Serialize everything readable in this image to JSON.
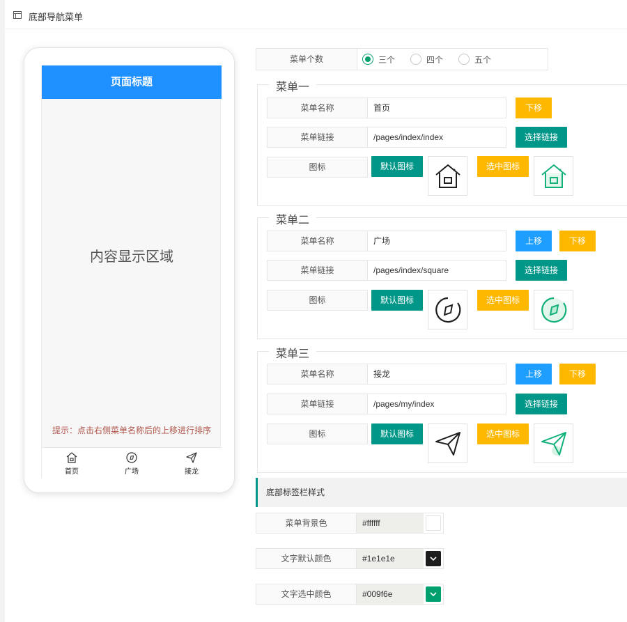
{
  "topbar": {
    "title": "底部导航菜单"
  },
  "phone": {
    "page_title": "页面标题",
    "content": "内容显示区域",
    "tip": "提示：点击右侧菜单名称后的上移进行排序",
    "tabs": [
      {
        "label": "首页",
        "icon": "home-icon"
      },
      {
        "label": "广场",
        "icon": "compass-icon"
      },
      {
        "label": "接龙",
        "icon": "paper-plane-icon"
      }
    ]
  },
  "count": {
    "label": "菜单个数",
    "options": [
      "三个",
      "四个",
      "五个"
    ],
    "selected": "三个"
  },
  "labels": {
    "name": "菜单名称",
    "link": "菜单链接",
    "icon": "图标",
    "choose_link": "选择链接",
    "default_icon": "默认图标",
    "selected_icon": "选中图标",
    "move_up": "上移",
    "move_down": "下移"
  },
  "menus": [
    {
      "legend": "菜单一",
      "name": "首页",
      "link": "/pages/index/index",
      "icon": "home-icon"
    },
    {
      "legend": "菜单二",
      "name": "广场",
      "link": "/pages/index/square",
      "icon": "compass-icon"
    },
    {
      "legend": "菜单三",
      "name": "接龙",
      "link": "/pages/my/index",
      "icon": "paper-plane-icon"
    }
  ],
  "style_section": {
    "title": "底部标签栏样式",
    "rows": [
      {
        "label": "菜单背景色",
        "value": "#ffffff"
      },
      {
        "label": "文字默认颜色",
        "value": "#1e1e1e"
      },
      {
        "label": "文字选中颜色",
        "value": "#009f6e"
      }
    ]
  },
  "colors": {
    "accent_green": "#009688",
    "selected_green": "#009f6e",
    "orange": "#ffb800",
    "blue": "#1e9fff",
    "phone_header": "#1e90ff"
  }
}
